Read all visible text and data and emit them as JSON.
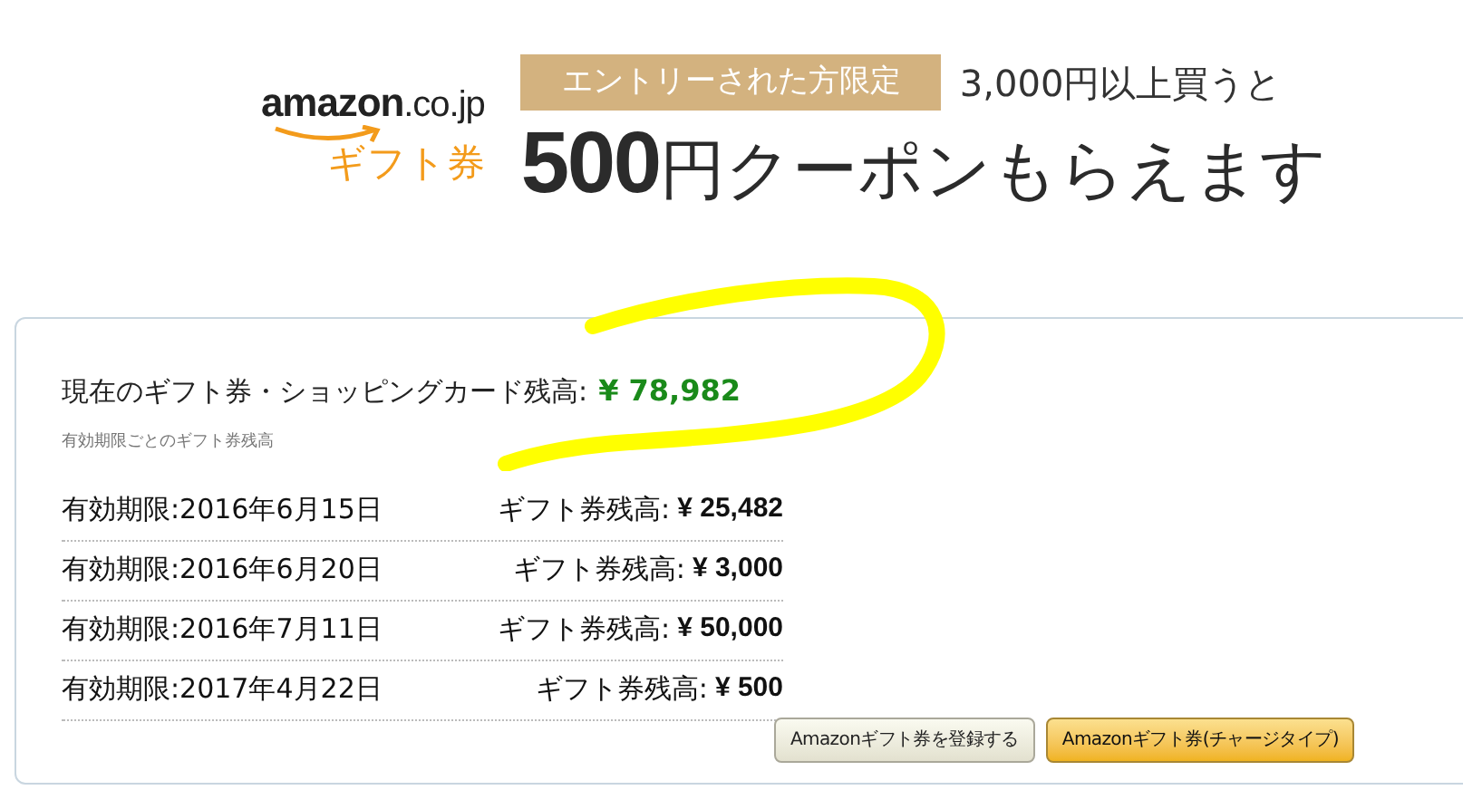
{
  "banner": {
    "logo": {
      "wordmark": "amazon",
      "domain": ".co.jp",
      "subtitle": "ギフト券"
    },
    "badge": "エントリーされた方限定",
    "condition": "3,000円以上買うと",
    "headline_amount": "500",
    "headline_rest": "円クーポンもらえます"
  },
  "balance": {
    "label": "現在のギフト券・ショッピングカード残高:",
    "amount": "¥ 78,982",
    "note": "有効期限ごとのギフト券残高"
  },
  "rows": [
    {
      "expiry": "有効期限:2016年6月15日",
      "balance_label": "ギフト券残高:",
      "amount": "¥ 25,482"
    },
    {
      "expiry": "有効期限:2016年6月20日",
      "balance_label": "ギフト券残高:",
      "amount": "¥ 3,000"
    },
    {
      "expiry": "有効期限:2016年7月11日",
      "balance_label": "ギフト券残高:",
      "amount": "¥ 50,000"
    },
    {
      "expiry": "有効期限:2017年4月22日",
      "balance_label": "ギフト券残高:",
      "amount": "¥ 500"
    }
  ],
  "buttons": [
    {
      "label": "Amazonギフト券を登録する",
      "kind": "secondary"
    },
    {
      "label": "Amazonギフト券(チャージタイプ)",
      "kind": "primary"
    }
  ]
}
